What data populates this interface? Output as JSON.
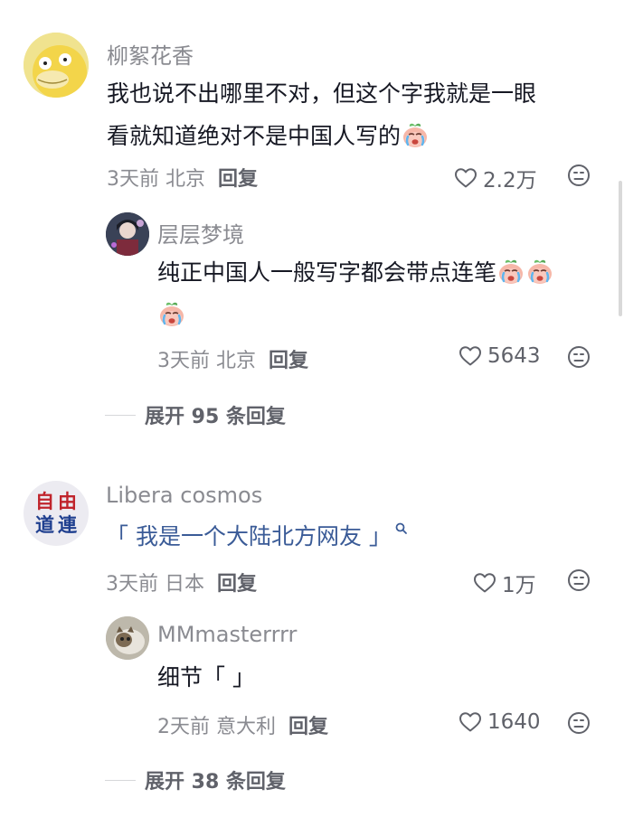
{
  "comments": [
    {
      "user": "柳絮花香",
      "text_line1": "我也说不出哪里不对，但这个字我就是一眼",
      "text_line2": "看就知道绝对不是中国人写的",
      "meta": "3天前 北京",
      "reply_label": "回复",
      "likes": "2.2万",
      "replies": [
        {
          "user": "层层梦境",
          "text": "纯正中国人一般写字都会带点连笔",
          "meta": "3天前 北京",
          "reply_label": "回复",
          "likes": "5643"
        }
      ],
      "expand_label": "展开 95 条回复"
    },
    {
      "user": "Libera cosmos",
      "avatar_text": [
        "自",
        "由",
        "道",
        "連"
      ],
      "text": "「 我是一个大陆北方网友 」",
      "meta": "3天前 日本",
      "reply_label": "回复",
      "likes": "1万",
      "replies": [
        {
          "user": "MMmasterrrr",
          "text": "细节「 」",
          "meta": "2天前 意大利",
          "reply_label": "回复",
          "likes": "1640"
        }
      ],
      "expand_label": "展开 38 条回复"
    }
  ],
  "icons": {
    "heart": "heart-outline-icon",
    "dislike": "smiley-dislike-icon",
    "emoji": "crying-peach-emoji",
    "search": "search-icon"
  },
  "colors": {
    "primary_text": "#161823",
    "secondary_text": "#8a8b91",
    "keyword_link": "#3a5b97"
  }
}
